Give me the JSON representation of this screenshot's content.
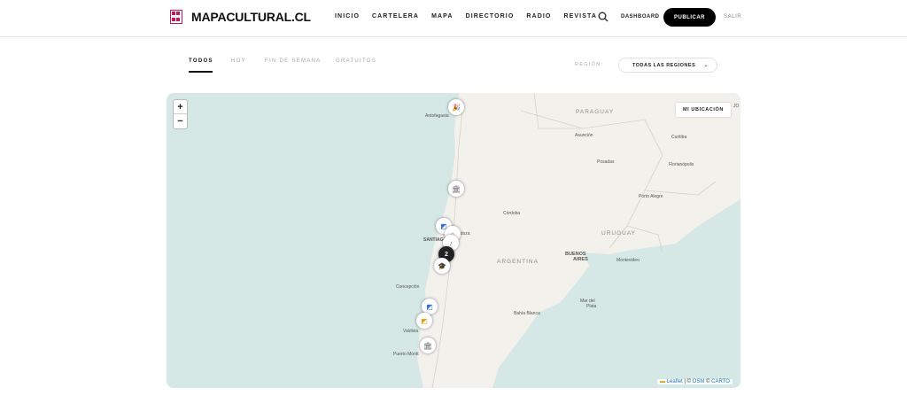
{
  "header": {
    "logo_text": "MAPACULTURAL.CL",
    "nav": [
      "INICIO",
      "CARTELERA",
      "MAPA",
      "DIRECTORIO",
      "RADIO",
      "REVISTA"
    ],
    "dashboard": "DASHBOARD",
    "publish": "PUBLICAR",
    "logout": "SALIR"
  },
  "filters": {
    "tabs": [
      "TODOS",
      "HOY",
      "FIN DE SEMANA",
      "GRATUITOS"
    ],
    "active_tab": "TODOS",
    "region_label": "REGIÓN:",
    "region_value": "TODAS LAS REGIONES"
  },
  "map": {
    "zoom_in": "+",
    "zoom_out": "−",
    "my_location": "MI UBICACIÓN",
    "attribution": {
      "leaflet": "Leaflet",
      "sep1": " | © ",
      "osm": "OSM",
      "sep2": " © ",
      "carto": "CARTO"
    },
    "countries": [
      "PARAGUAY",
      "URUGUAY",
      "ARGENTINA"
    ],
    "cities": [
      "Antofagasta",
      "Asunción",
      "Curitiba",
      "Posadas",
      "Florianópolis",
      "Porto Alegre",
      "Córdoba",
      "Mendoza",
      "SANTIAGO",
      "BUENOS",
      "AIRES",
      "Montevideo",
      "Concepción",
      "Mar del",
      "Plata",
      "Bahía Blanca",
      "Valdivia",
      "Puerto Montt",
      "JO"
    ],
    "cluster_count": "2"
  },
  "colors": {
    "accent": "#c2185b",
    "water": "#d5e8e6",
    "land": "#f3f1ec",
    "button_bg": "#000000"
  }
}
